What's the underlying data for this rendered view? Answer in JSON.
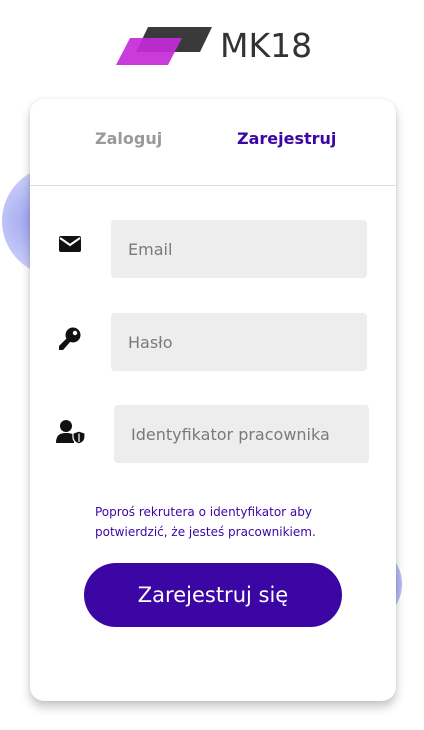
{
  "brand": {
    "name": "MK18",
    "colors": {
      "primary": "#3c06a5",
      "accent": "#c42ad8",
      "dark": "#3a3a3a"
    }
  },
  "tabs": [
    {
      "label": "Zaloguj",
      "active": false
    },
    {
      "label": "Zarejestruj",
      "active": true
    }
  ],
  "form": {
    "email": {
      "placeholder": "Email",
      "value": "",
      "icon": "envelope-icon"
    },
    "password": {
      "placeholder": "Hasło",
      "value": "",
      "icon": "key-icon"
    },
    "employee_id": {
      "placeholder": "Identyfikator pracownika",
      "value": "",
      "icon": "user-shield-icon"
    },
    "hint": "Poproś rekrutera o identyfikator aby potwierdzić, że jesteś pracownikiem.",
    "submit_label": "Zarejestruj się"
  }
}
